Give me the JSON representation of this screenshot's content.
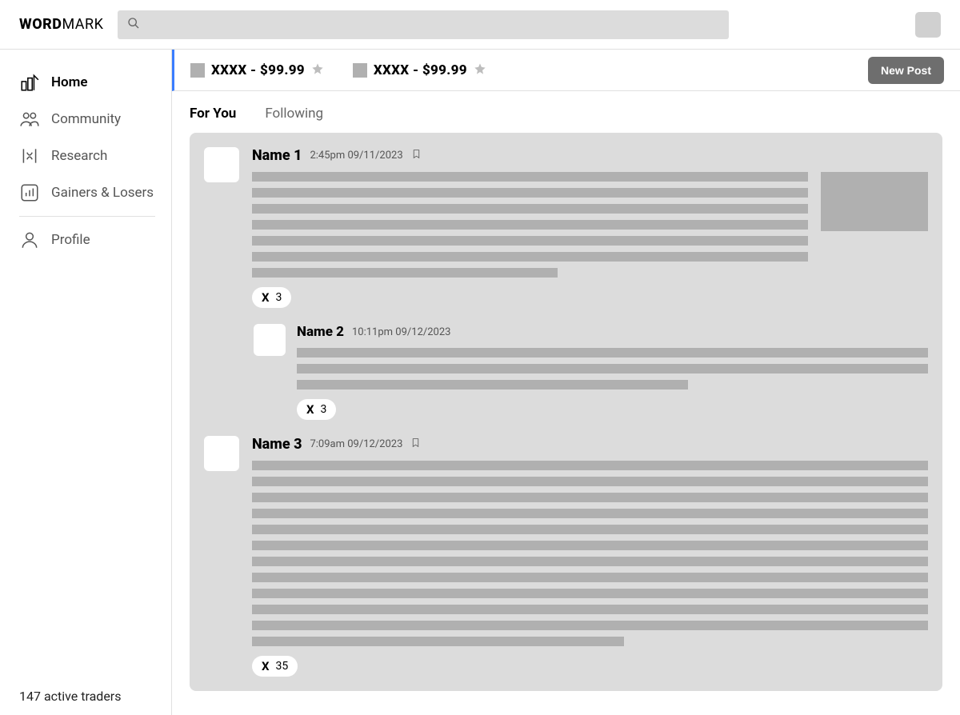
{
  "logo": {
    "bold": "WORD",
    "light": "MARK"
  },
  "sidebar": {
    "items": [
      {
        "label": "Home",
        "active": true
      },
      {
        "label": "Community",
        "active": false
      },
      {
        "label": "Research",
        "active": false
      },
      {
        "label": "Gainers & Losers",
        "active": false
      }
    ],
    "profile_label": "Profile",
    "footer": "147 active traders"
  },
  "tickers": [
    {
      "symbol": "XXXX",
      "price": "$99.99"
    },
    {
      "symbol": "XXXX",
      "price": "$99.99"
    }
  ],
  "new_post_label": "New Post",
  "tabs": [
    {
      "label": "For You",
      "active": true
    },
    {
      "label": "Following",
      "active": false
    }
  ],
  "posts": [
    {
      "name": "Name 1",
      "time": "2:45pm 09/11/2023",
      "bookmark": true,
      "has_image": true,
      "reaction_count": "3",
      "reply": {
        "name": "Name 2",
        "time": "10:11pm 09/12/2023",
        "reaction_count": "3"
      }
    },
    {
      "name": "Name 3",
      "time": "7:09am 09/12/2023",
      "bookmark": true,
      "has_image": false,
      "reaction_count": "35"
    }
  ]
}
